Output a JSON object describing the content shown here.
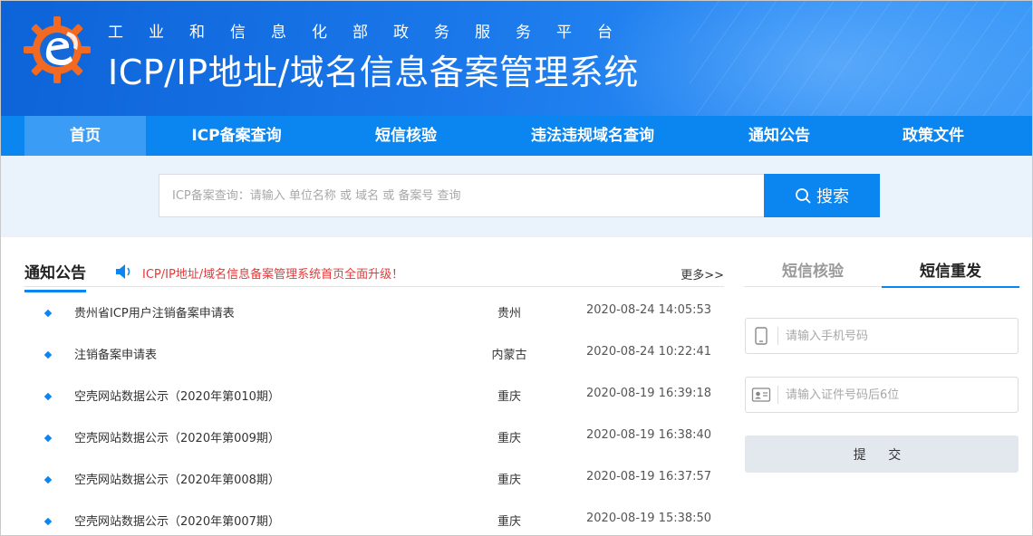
{
  "header": {
    "subtitle": "工业和信息化部政务服务平台",
    "title": "ICP/IP地址/域名信息备案管理系统",
    "colors": {
      "brand": "#0b86f0",
      "logo_orange": "#f26a21"
    }
  },
  "nav": {
    "items": [
      {
        "label": "首页",
        "active": true
      },
      {
        "label": "ICP备案查询",
        "active": false
      },
      {
        "label": "短信核验",
        "active": false
      },
      {
        "label": "违法违规域名查询",
        "active": false
      },
      {
        "label": "通知公告",
        "active": false
      },
      {
        "label": "政策文件",
        "active": false
      }
    ]
  },
  "search": {
    "placeholder": "ICP备案查询：请输入 单位名称 或 域名 或 备案号 查询",
    "button_label": "搜索",
    "icon": "search-icon"
  },
  "notices": {
    "title": "通知公告",
    "marquee": "ICP/IP地址/域名信息备案管理系统首页全面升级！",
    "more_label": "更多>>",
    "rows": [
      {
        "title": "贵州省ICP用户注销备案申请表",
        "region": "贵州",
        "date": "2020-08-24 14:05:53"
      },
      {
        "title": "注销备案申请表",
        "region": "内蒙古",
        "date": "2020-08-24 10:22:41"
      },
      {
        "title": "空壳网站数据公示（2020年第010期）",
        "region": "重庆",
        "date": "2020-08-19 16:39:18"
      },
      {
        "title": "空壳网站数据公示（2020年第009期）",
        "region": "重庆",
        "date": "2020-08-19 16:38:40"
      },
      {
        "title": "空壳网站数据公示（2020年第008期）",
        "region": "重庆",
        "date": "2020-08-19 16:37:57"
      },
      {
        "title": "空壳网站数据公示（2020年第007期）",
        "region": "重庆",
        "date": "2020-08-19 15:38:50"
      }
    ]
  },
  "sms": {
    "tabs": [
      {
        "label": "短信核验",
        "active": false
      },
      {
        "label": "短信重发",
        "active": true
      }
    ],
    "phone_placeholder": "请输入手机号码",
    "id_placeholder": "请输入证件号码后6位",
    "submit_label": "提 交"
  }
}
